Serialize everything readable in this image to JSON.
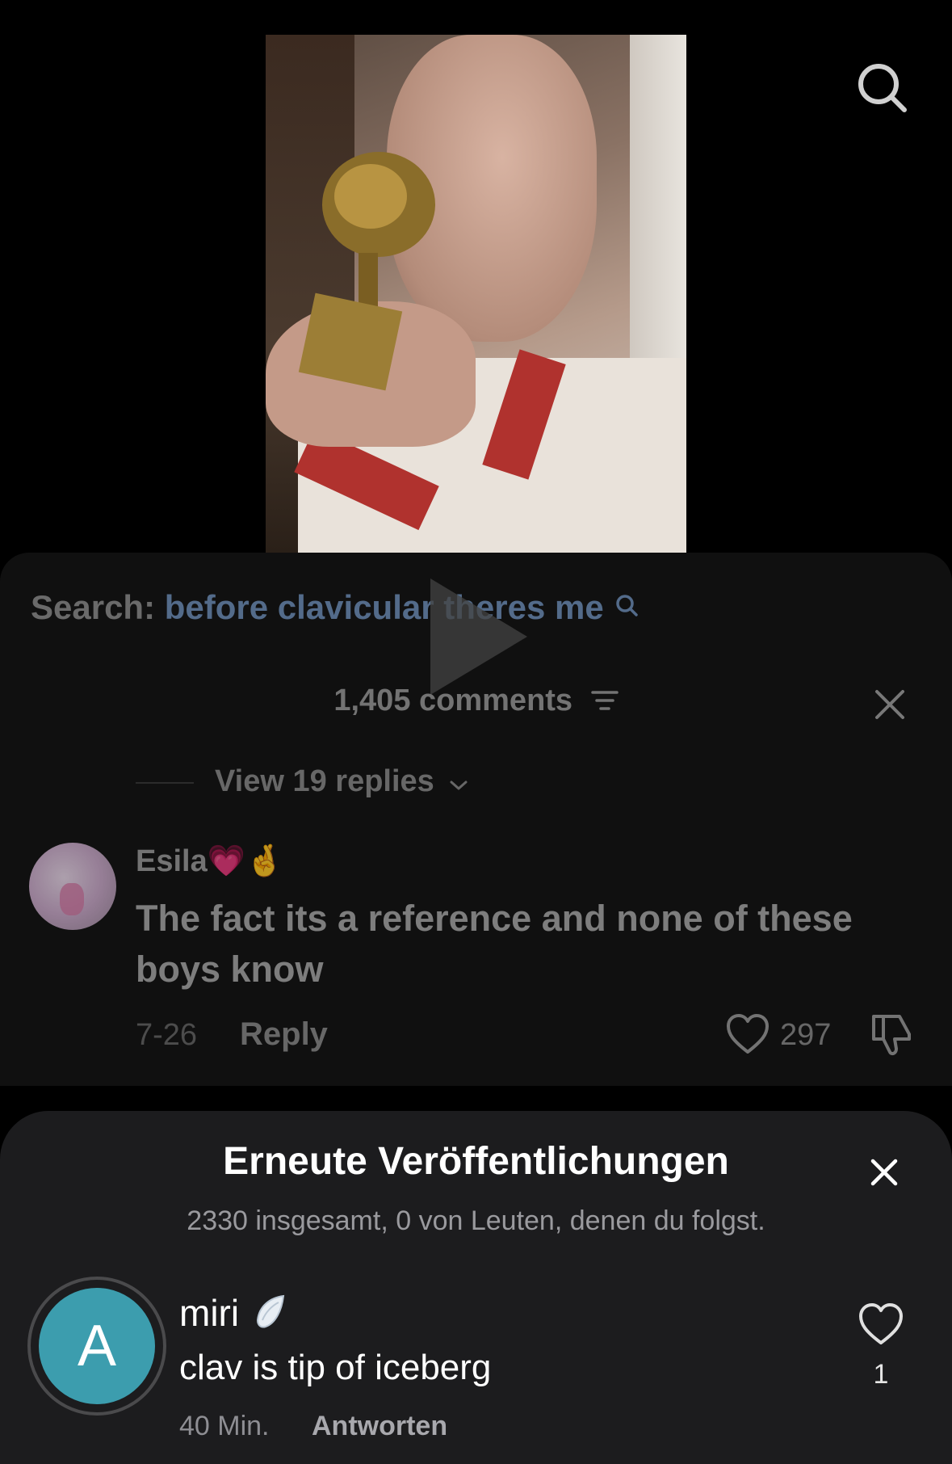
{
  "search_overlay": {
    "label": "Search:",
    "term": "before clavicular theres me"
  },
  "comments": {
    "count_label": "1,405 comments",
    "view_replies": "View 19 replies",
    "comment": {
      "username": "Esila💗🤞",
      "text": "The fact its a reference and none of these boys know",
      "date": "7-26",
      "reply_label": "Reply",
      "likes": "297"
    }
  },
  "reposts_sheet": {
    "title": "Erneute Veröffentlichungen",
    "subtitle": "2330 insgesamt, 0 von Leuten, denen du folgst.",
    "item": {
      "avatar_letter": "A",
      "username": "miri",
      "text": "clav is tip of iceberg",
      "time": "40 Min.",
      "reply_label": "Antworten",
      "likes": "1"
    }
  },
  "icons": {
    "search": "search-icon",
    "play": "play-icon",
    "filter": "filter-icon",
    "close": "close-icon",
    "chevron": "chevron-down-icon",
    "heart": "heart-icon",
    "dislike": "dislike-icon",
    "wing": "wing-icon"
  },
  "colors": {
    "search_term": "#6f8fb8",
    "avatar_bg": "#3c9dae",
    "panel_bg": "#161616",
    "sheet_bg": "#1c1c1e"
  }
}
